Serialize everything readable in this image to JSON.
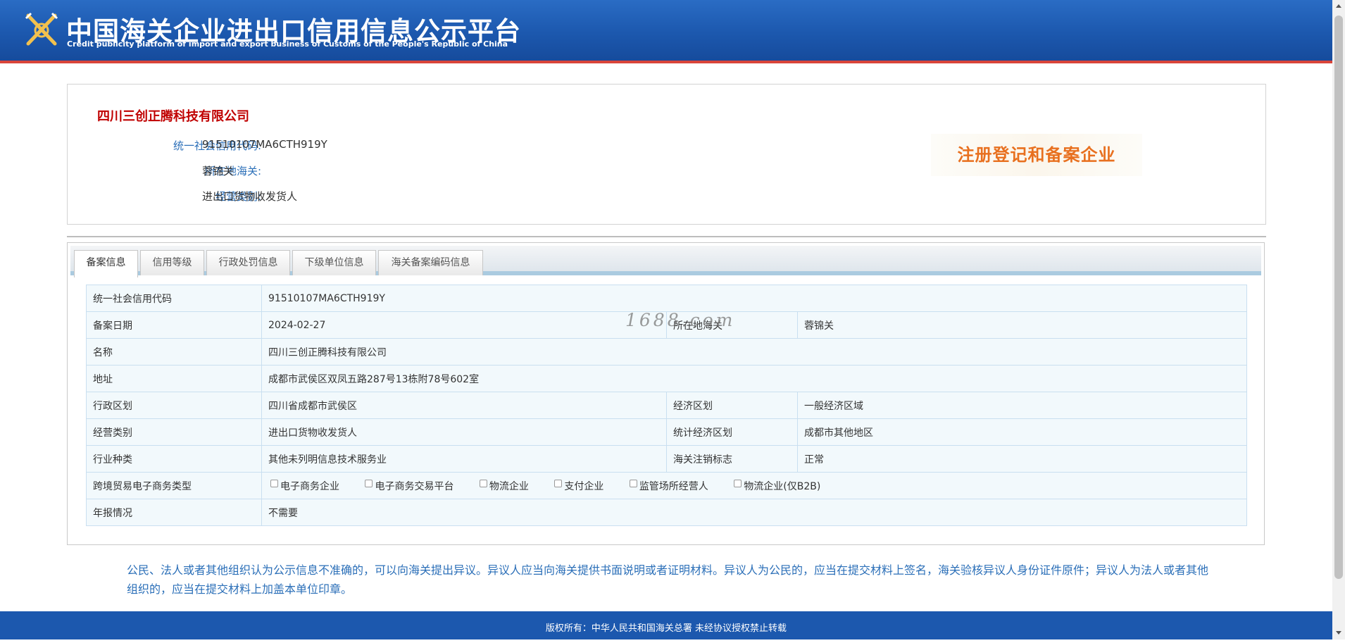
{
  "header": {
    "title_cn": "中国海关企业进出口信用信息公示平台",
    "title_en": "Credit publicity platform of import and export business of Customs of the People's Republic of China",
    "emblem_icon": "customs-emblem-icon"
  },
  "company": {
    "name": "四川三创正腾科技有限公司",
    "fields": [
      {
        "label": "统一社会信用代码:",
        "value": "91510107MA6CTH919Y"
      },
      {
        "label": "所在地海关:",
        "value": "蓉锦关"
      },
      {
        "label": "经营类别:",
        "value": "进出口货物收发货人"
      }
    ],
    "badge": "注册登记和备案企业"
  },
  "tabs": [
    {
      "label": "备案信息",
      "active": true
    },
    {
      "label": "信用等级",
      "active": false
    },
    {
      "label": "行政处罚信息",
      "active": false
    },
    {
      "label": "下级单位信息",
      "active": false
    },
    {
      "label": "海关备案编码信息",
      "active": false
    }
  ],
  "table": {
    "credit_code_label": "统一社会信用代码",
    "credit_code": "91510107MA6CTH919Y",
    "record_date_label": "备案日期",
    "record_date": "2024-02-27",
    "customs_label": "所在地海关",
    "customs": "蓉锦关",
    "name_label": "名称",
    "name": "四川三创正腾科技有限公司",
    "address_label": "地址",
    "address": "成都市武侯区双凤五路287号13栋附78号602室",
    "admin_region_label": "行政区划",
    "admin_region": "四川省成都市武侯区",
    "econ_region_label": "经济区划",
    "econ_region": "一般经济区域",
    "business_type_label": "经营类别",
    "business_type": "进出口货物收发货人",
    "stat_region_label": "统计经济区划",
    "stat_region": "成都市其他地区",
    "industry_label": "行业种类",
    "industry": "其他未列明信息技术服务业",
    "cancel_flag_label": "海关注销标志",
    "cancel_flag": "正常",
    "ecommerce_label": "跨境贸易电子商务类型",
    "ecommerce_options": [
      "电子商务企业",
      "电子商务交易平台",
      "物流企业",
      "支付企业",
      "监管场所经营人",
      "物流企业(仅B2B)"
    ],
    "annual_report_label": "年报情况",
    "annual_report": "不需要"
  },
  "watermark": "1688.com",
  "notice": "公民、法人或者其他组织认为公示信息不准确的，可以向海关提出异议。异议人应当向海关提供书面说明或者证明材料。异议人为公民的，应当在提交材料上签名，海关验核异议人身份证件原件；异议人为法人或者其他组织的，应当在提交材料上加盖本单位印章。",
  "footer": "版权所有：中华人民共和国海关总署    未经协议授权禁止转载",
  "colors": {
    "header_blue": "#1c58ae",
    "accent_red": "#c00000",
    "label_blue": "#2b6fb8",
    "badge_orange": "#e8701f"
  }
}
